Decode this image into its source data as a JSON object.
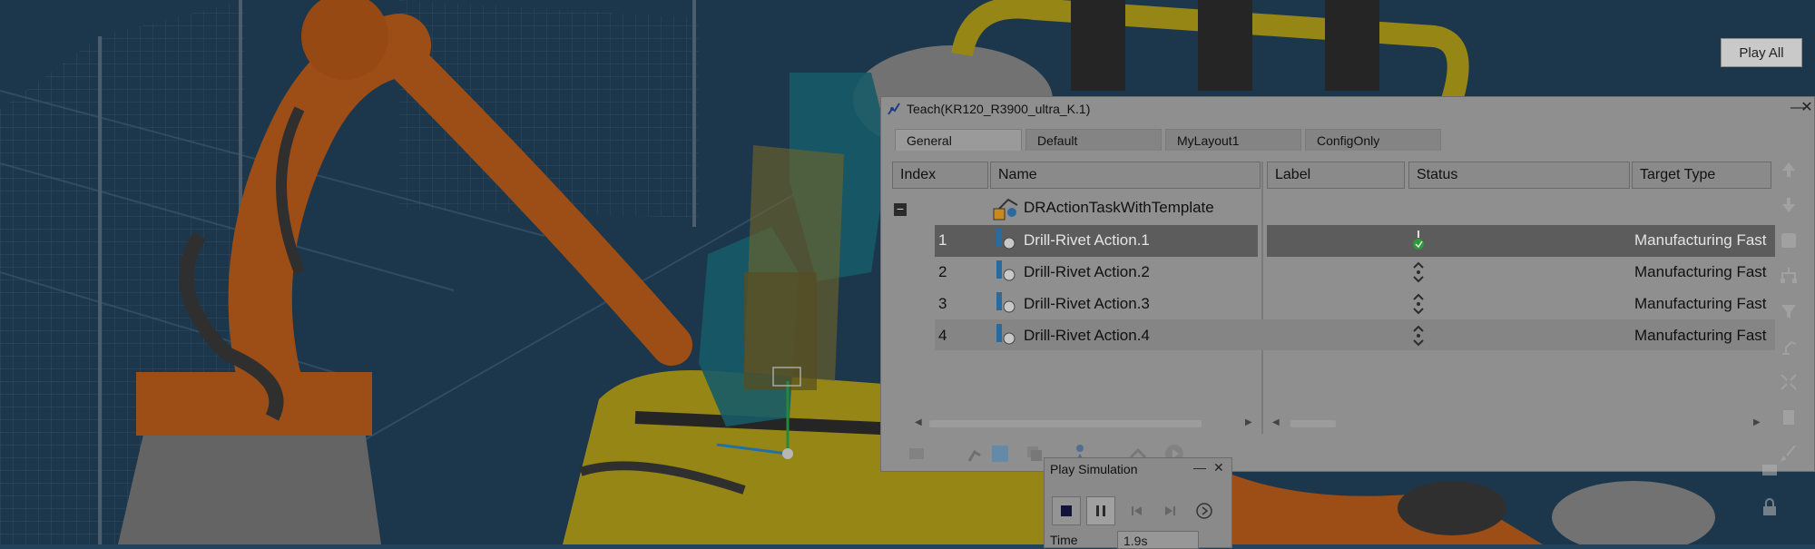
{
  "toolbar": {
    "play_all_label": "Play All"
  },
  "teach_panel": {
    "title": "Teach(KR120_R3900_ultra_K.1)",
    "tabs": [
      {
        "label": "General",
        "active": true
      },
      {
        "label": "Default",
        "active": false
      },
      {
        "label": "MyLayout1",
        "active": false
      },
      {
        "label": "ConfigOnly",
        "active": false
      }
    ],
    "columns": [
      "Index",
      "Name",
      "Label",
      "Status",
      "Target Type"
    ],
    "root": {
      "name": "DRActionTaskWithTemplate",
      "collapse_symbol": "−"
    },
    "rows": [
      {
        "index": "1",
        "name": "Drill-Rivet Action.1",
        "label": "",
        "status_icon": "status-active-icon",
        "target_type": "Manufacturing Fast",
        "selected": true
      },
      {
        "index": "2",
        "name": "Drill-Rivet Action.2",
        "label": "",
        "status_icon": "status-pending-icon",
        "target_type": "Manufacturing Fast",
        "selected": false
      },
      {
        "index": "3",
        "name": "Drill-Rivet Action.3",
        "label": "",
        "status_icon": "status-pending-icon",
        "target_type": "Manufacturing Fast",
        "selected": false
      },
      {
        "index": "4",
        "name": "Drill-Rivet Action.4",
        "label": "",
        "status_icon": "status-pending-icon",
        "target_type": "Manufacturing Fast",
        "selected": false
      }
    ]
  },
  "play_simulation": {
    "title": "Play Simulation",
    "time_label": "Time",
    "time_value": "1.9s"
  },
  "colors": {
    "background_blue": "#23435d",
    "robot_orange": "#c0601c",
    "fixture_yellow": "#b8a41a",
    "tool_teal": "#1d6f7e",
    "selection_gray": "#5c5c5c"
  }
}
